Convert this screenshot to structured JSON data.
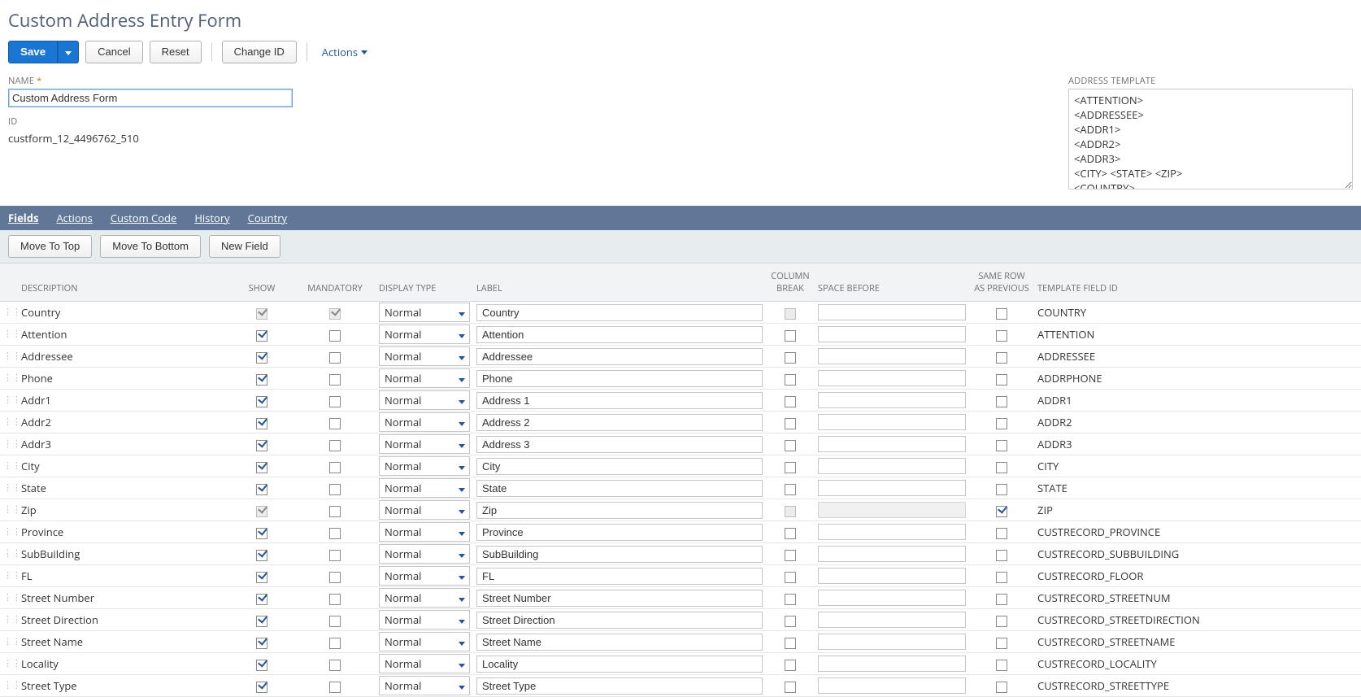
{
  "page": {
    "title": "Custom Address Entry Form"
  },
  "toolbar": {
    "save": "Save",
    "cancel": "Cancel",
    "reset": "Reset",
    "changeId": "Change ID",
    "actions": "Actions"
  },
  "headerFields": {
    "nameLabel": "NAME",
    "nameValue": "Custom Address Form",
    "idLabel": "ID",
    "idValue": "custform_12_4496762_510",
    "addressTemplateLabel": "ADDRESS TEMPLATE",
    "addressTemplateValue": "<ATTENTION>\n<ADDRESSEE>\n<ADDR1>\n<ADDR2>\n<ADDR3>\n<CITY> <STATE> <ZIP>\n<COUNTRY>"
  },
  "subtabs": {
    "fields": "Fields",
    "actions": "Actions",
    "customCode": "Custom Code",
    "history": "History",
    "country": "Country"
  },
  "sublistToolbar": {
    "moveTop": "Move To Top",
    "moveBottom": "Move To Bottom",
    "newField": "New Field"
  },
  "columns": {
    "description": "DESCRIPTION",
    "show": "SHOW",
    "mandatory": "MANDATORY",
    "displayType": "DISPLAY TYPE",
    "label": "LABEL",
    "columnBreak": "COLUMN BREAK",
    "spaceBefore": "SPACE BEFORE",
    "sameRow": "SAME ROW AS PREVIOUS",
    "templateId": "TEMPLATE FIELD ID"
  },
  "rows": [
    {
      "description": "Country",
      "show": true,
      "showDisabled": true,
      "mandatory": true,
      "mandatoryDisabled": true,
      "displayType": "Normal",
      "label": "Country",
      "columnBreak": false,
      "columnBreakDisabled": true,
      "spaceBefore": "",
      "spaceDisabled": false,
      "sameRow": false,
      "templateId": "COUNTRY"
    },
    {
      "description": "Attention",
      "show": true,
      "showDisabled": false,
      "mandatory": false,
      "mandatoryDisabled": false,
      "displayType": "Normal",
      "label": "Attention",
      "columnBreak": false,
      "columnBreakDisabled": false,
      "spaceBefore": "",
      "spaceDisabled": false,
      "sameRow": false,
      "templateId": "ATTENTION"
    },
    {
      "description": "Addressee",
      "show": true,
      "showDisabled": false,
      "mandatory": false,
      "mandatoryDisabled": false,
      "displayType": "Normal",
      "label": "Addressee",
      "columnBreak": false,
      "columnBreakDisabled": false,
      "spaceBefore": "",
      "spaceDisabled": false,
      "sameRow": false,
      "templateId": "ADDRESSEE"
    },
    {
      "description": "Phone",
      "show": true,
      "showDisabled": false,
      "mandatory": false,
      "mandatoryDisabled": false,
      "displayType": "Normal",
      "label": "Phone",
      "columnBreak": false,
      "columnBreakDisabled": false,
      "spaceBefore": "",
      "spaceDisabled": false,
      "sameRow": false,
      "templateId": "ADDRPHONE"
    },
    {
      "description": "Addr1",
      "show": true,
      "showDisabled": false,
      "mandatory": false,
      "mandatoryDisabled": false,
      "displayType": "Normal",
      "label": "Address 1",
      "columnBreak": false,
      "columnBreakDisabled": false,
      "spaceBefore": "",
      "spaceDisabled": false,
      "sameRow": false,
      "templateId": "ADDR1"
    },
    {
      "description": "Addr2",
      "show": true,
      "showDisabled": false,
      "mandatory": false,
      "mandatoryDisabled": false,
      "displayType": "Normal",
      "label": "Address 2",
      "columnBreak": false,
      "columnBreakDisabled": false,
      "spaceBefore": "",
      "spaceDisabled": false,
      "sameRow": false,
      "templateId": "ADDR2"
    },
    {
      "description": "Addr3",
      "show": true,
      "showDisabled": false,
      "mandatory": false,
      "mandatoryDisabled": false,
      "displayType": "Normal",
      "label": "Address 3",
      "columnBreak": false,
      "columnBreakDisabled": false,
      "spaceBefore": "",
      "spaceDisabled": false,
      "sameRow": false,
      "templateId": "ADDR3"
    },
    {
      "description": "City",
      "show": true,
      "showDisabled": false,
      "mandatory": false,
      "mandatoryDisabled": false,
      "displayType": "Normal",
      "label": "City",
      "columnBreak": false,
      "columnBreakDisabled": false,
      "spaceBefore": "",
      "spaceDisabled": false,
      "sameRow": false,
      "templateId": "CITY"
    },
    {
      "description": "State",
      "show": true,
      "showDisabled": false,
      "mandatory": false,
      "mandatoryDisabled": false,
      "displayType": "Normal",
      "label": "State",
      "columnBreak": false,
      "columnBreakDisabled": false,
      "spaceBefore": "",
      "spaceDisabled": false,
      "sameRow": false,
      "templateId": "STATE"
    },
    {
      "description": "Zip",
      "show": true,
      "showDisabled": true,
      "mandatory": false,
      "mandatoryDisabled": false,
      "displayType": "Normal",
      "label": "Zip",
      "columnBreak": false,
      "columnBreakDisabled": true,
      "spaceBefore": "",
      "spaceDisabled": true,
      "sameRow": true,
      "templateId": "ZIP"
    },
    {
      "description": "Province",
      "show": true,
      "showDisabled": false,
      "mandatory": false,
      "mandatoryDisabled": false,
      "displayType": "Normal",
      "label": "Province",
      "columnBreak": false,
      "columnBreakDisabled": false,
      "spaceBefore": "",
      "spaceDisabled": false,
      "sameRow": false,
      "templateId": "CUSTRECORD_PROVINCE"
    },
    {
      "description": "SubBuilding",
      "show": true,
      "showDisabled": false,
      "mandatory": false,
      "mandatoryDisabled": false,
      "displayType": "Normal",
      "label": "SubBuilding",
      "columnBreak": false,
      "columnBreakDisabled": false,
      "spaceBefore": "",
      "spaceDisabled": false,
      "sameRow": false,
      "templateId": "CUSTRECORD_SUBBUILDING"
    },
    {
      "description": "FL",
      "show": true,
      "showDisabled": false,
      "mandatory": false,
      "mandatoryDisabled": false,
      "displayType": "Normal",
      "label": "FL",
      "columnBreak": false,
      "columnBreakDisabled": false,
      "spaceBefore": "",
      "spaceDisabled": false,
      "sameRow": false,
      "templateId": "CUSTRECORD_FLOOR"
    },
    {
      "description": "Street Number",
      "show": true,
      "showDisabled": false,
      "mandatory": false,
      "mandatoryDisabled": false,
      "displayType": "Normal",
      "label": "Street Number",
      "columnBreak": false,
      "columnBreakDisabled": false,
      "spaceBefore": "",
      "spaceDisabled": false,
      "sameRow": false,
      "templateId": "CUSTRECORD_STREETNUM"
    },
    {
      "description": "Street Direction",
      "show": true,
      "showDisabled": false,
      "mandatory": false,
      "mandatoryDisabled": false,
      "displayType": "Normal",
      "label": "Street Direction",
      "columnBreak": false,
      "columnBreakDisabled": false,
      "spaceBefore": "",
      "spaceDisabled": false,
      "sameRow": false,
      "templateId": "CUSTRECORD_STREETDIRECTION"
    },
    {
      "description": "Street Name",
      "show": true,
      "showDisabled": false,
      "mandatory": false,
      "mandatoryDisabled": false,
      "displayType": "Normal",
      "label": "Street Name",
      "columnBreak": false,
      "columnBreakDisabled": false,
      "spaceBefore": "",
      "spaceDisabled": false,
      "sameRow": false,
      "templateId": "CUSTRECORD_STREETNAME"
    },
    {
      "description": "Locality",
      "show": true,
      "showDisabled": false,
      "mandatory": false,
      "mandatoryDisabled": false,
      "displayType": "Normal",
      "label": "Locality",
      "columnBreak": false,
      "columnBreakDisabled": false,
      "spaceBefore": "",
      "spaceDisabled": false,
      "sameRow": false,
      "templateId": "CUSTRECORD_LOCALITY"
    },
    {
      "description": "Street Type",
      "show": true,
      "showDisabled": false,
      "mandatory": false,
      "mandatoryDisabled": false,
      "displayType": "Normal",
      "label": "Street Type",
      "columnBreak": false,
      "columnBreakDisabled": false,
      "spaceBefore": "",
      "spaceDisabled": false,
      "sameRow": false,
      "templateId": "CUSTRECORD_STREETTYPE"
    }
  ]
}
